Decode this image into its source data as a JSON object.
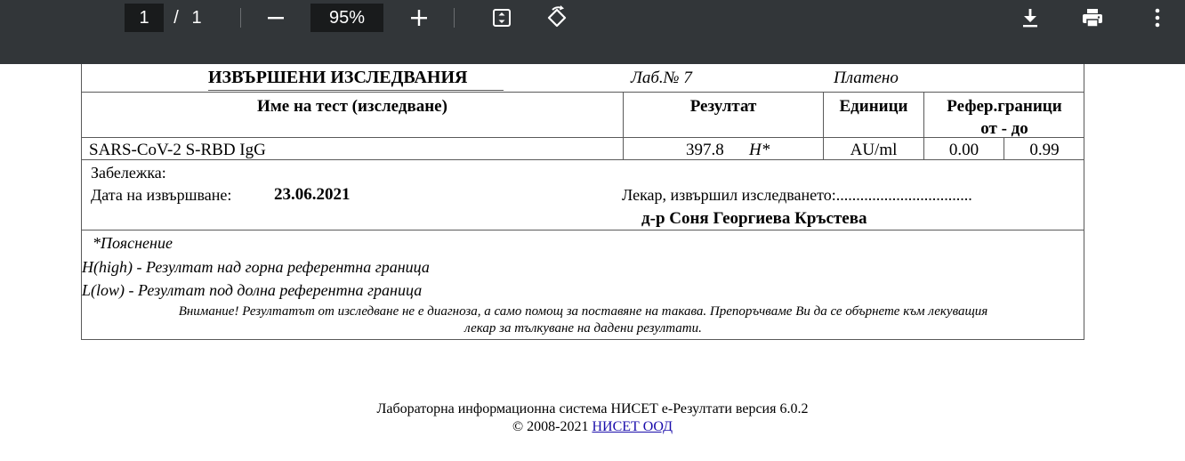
{
  "toolbar": {
    "page_current": "1",
    "page_separator": "/",
    "page_total": "1",
    "zoom_out_icon": "minus-icon",
    "zoom_level": "95%",
    "zoom_in_icon": "plus-icon",
    "fit_icon": "fit-to-page-icon",
    "rotate_icon": "rotate-icon",
    "download_icon": "download-icon",
    "print_icon": "print-icon",
    "more_icon": "more-vertical-icon",
    "background_color": "#323639"
  },
  "report": {
    "title": "ИЗВЪРШЕНИ ИЗСЛЕДВАНИЯ",
    "lab_no": "Лаб.№ 7",
    "paid": "Платено",
    "columns": {
      "test_name": "Име на тест (изследване)",
      "result": "Резултат",
      "units": "Единици",
      "reference": "Рефер.граници",
      "reference_range": "от - до"
    },
    "rows": [
      {
        "test": "SARS-CoV-2 S-RBD IgG",
        "value": "397.8",
        "flag": "H*",
        "unit": "AU/ml",
        "ref_from": "0.00",
        "ref_to": "0.99"
      }
    ],
    "note_label": "Забележка:",
    "date_label": "Дата на извършване:",
    "date_value": "23.06.2021",
    "doctor_label": "Лекар, извършил изследването:..................................",
    "doctor_name": "д-р Соня Георгиева Кръстева",
    "explanation_title": "*Пояснение",
    "explanation_high": "H(high) - Резултат над горна референтна граница",
    "explanation_low": "L(low) - Резултат под долна референтна граница",
    "warning_line1": "Внимание! Резултатът от изследване не е диагноза, а само помощ за поставяне на такава. Препоръчваме Ви да се обърнете към лекуващия",
    "warning_line2": "лекар за тълкуване на дадени резултати."
  },
  "footer": {
    "system": "Лабораторна информационна система НИСЕТ е-Резултати версия 6.0.2",
    "copyright": "© 2008-2021",
    "company_link": "НИСЕТ ООД",
    "link_color": "#1a0dab"
  }
}
